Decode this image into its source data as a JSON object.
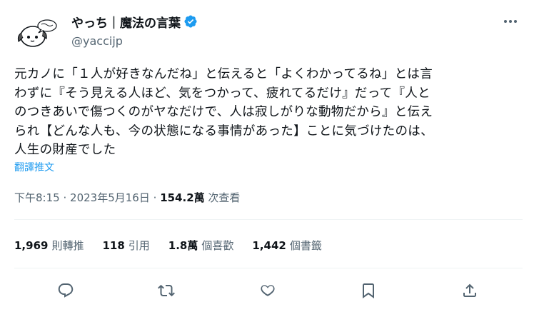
{
  "author": {
    "display_name": "やっち｜魔法の言葉",
    "handle": "@yaccijp",
    "verified": true
  },
  "tweet": {
    "lines": [
      "元カノに「１人が好きなんだね」と伝えると「よくわかってるね」とは言",
      "わずに『そう見える人ほど、気をつかって、疲れてるだけ』だって『人と",
      "のつきあいで傷つくのがヤなだけで、人は寂しがりな動物だから』と伝え",
      "られ【どんな人も、今の状態になる事情があった】ことに気づけたのは、",
      "人生の財産でした"
    ],
    "translate_label": "翻譯推文"
  },
  "meta": {
    "time": "下午8:15",
    "separator": "·",
    "date": "2023年5月16日",
    "views_count": "154.2萬",
    "views_label": "次查看"
  },
  "stats": {
    "retweets": {
      "count": "1,969",
      "label": "則轉推"
    },
    "quotes": {
      "count": "118",
      "label": "引用"
    },
    "likes": {
      "count": "1.8萬",
      "label": "個喜歡"
    },
    "bookmarks": {
      "count": "1,442",
      "label": "個書籤"
    }
  },
  "icons": {
    "verified": "verified-badge-icon",
    "more": "more-dots-icon",
    "reply": "reply-icon",
    "retweet": "retweet-icon",
    "like": "heart-icon",
    "bookmark": "bookmark-icon",
    "share": "share-icon"
  },
  "colors": {
    "accent": "#1d9bf0",
    "text": "#0f1419",
    "secondary": "#536471",
    "divider": "#eff3f4"
  }
}
